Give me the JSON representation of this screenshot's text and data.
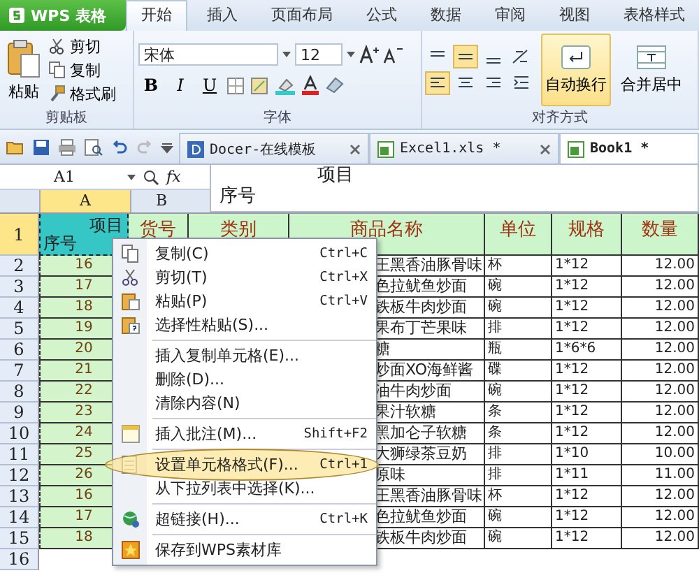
{
  "app_button": {
    "label": "WPS 表格"
  },
  "ribbon_tabs": [
    {
      "label": "开始",
      "selected": true
    },
    {
      "label": "插入",
      "selected": false
    },
    {
      "label": "页面布局",
      "selected": false
    },
    {
      "label": "公式",
      "selected": false
    },
    {
      "label": "数据",
      "selected": false
    },
    {
      "label": "审阅",
      "selected": false
    },
    {
      "label": "视图",
      "selected": false
    },
    {
      "label": "表格样式",
      "selected": false
    }
  ],
  "ribbon": {
    "clipboard": {
      "paste": "粘贴",
      "cut": "剪切",
      "copy": "复制",
      "format_painter": "格式刷",
      "group_label": "剪贴板"
    },
    "font": {
      "name": "宋体",
      "size": "12",
      "bold": "B",
      "italic": "I",
      "underline": "U",
      "group_label": "字体"
    },
    "alignment": {
      "wrap_text": {
        "label": "自动换行",
        "on": true
      },
      "merge_center": "合并居中",
      "group_label": "对齐方式"
    }
  },
  "document_tabs": [
    {
      "label": "Docer-在线模板",
      "selected": false
    },
    {
      "label": "Excel1.xls *",
      "selected": false
    },
    {
      "label": "Book1 *",
      "selected": true
    }
  ],
  "formula_bar": {
    "cell_ref": "A1",
    "fx": "fx",
    "popup_lines": [
      "项目",
      "序号"
    ]
  },
  "column_headers": [
    {
      "label": "A",
      "selected": true
    },
    {
      "label": "B",
      "selected": false
    }
  ],
  "header_row": {
    "row": "1",
    "selected": true,
    "first_cell": {
      "top": "项目",
      "bottom": "序号"
    },
    "cells": [
      "货号",
      "类别",
      "商品名称",
      "单位",
      "规格",
      "数量"
    ]
  },
  "rows": [
    {
      "row": "2",
      "no": "16",
      "name": "王黑香油豚骨味",
      "unit": "杯",
      "spec": "1*12",
      "qty": "12.00"
    },
    {
      "row": "3",
      "no": "17",
      "name": "色拉鱿鱼炒面",
      "unit": "碗",
      "spec": "1*12",
      "qty": "12.00"
    },
    {
      "row": "4",
      "no": "18",
      "name": "铁板牛肉炒面",
      "unit": "碗",
      "spec": "1*12",
      "qty": "12.00"
    },
    {
      "row": "5",
      "no": "19",
      "name": "果布丁芒果味",
      "unit": "排",
      "spec": "1*12",
      "qty": "12.00"
    },
    {
      "row": "6",
      "no": "20",
      "name": "糖",
      "unit": "瓶",
      "spec": "1*6*6",
      "qty": "12.00"
    },
    {
      "row": "7",
      "no": "21",
      "name": "炒面XO海鲜酱",
      "unit": "碟",
      "spec": "1*12",
      "qty": "12.00"
    },
    {
      "row": "8",
      "no": "22",
      "name": "油牛肉炒面",
      "unit": "碗",
      "spec": "1*12",
      "qty": "12.00"
    },
    {
      "row": "9",
      "no": "23",
      "name": "果汁软糖",
      "unit": "条",
      "spec": "1*12",
      "qty": "12.00"
    },
    {
      "row": "10",
      "no": "24",
      "name": "黑加仑子软糖",
      "unit": "条",
      "spec": "1*12",
      "qty": "12.00"
    },
    {
      "row": "11",
      "no": "25",
      "name": "大狮绿茶豆奶",
      "unit": "排",
      "spec": "1*10",
      "qty": "10.00"
    },
    {
      "row": "12",
      "no": "26",
      "name": "原味",
      "unit": "排",
      "spec": "1*11",
      "qty": "11.00"
    },
    {
      "row": "13",
      "no": "16",
      "name": "王黑香油豚骨味",
      "unit": "杯",
      "spec": "1*12",
      "qty": "12.00"
    },
    {
      "row": "14",
      "no": "17",
      "name": "色拉鱿鱼炒面",
      "unit": "碗",
      "spec": "1*12",
      "qty": "12.00"
    },
    {
      "row": "15",
      "no": "18",
      "name": "铁板牛肉炒面",
      "unit": "碗",
      "spec": "1*12",
      "qty": "12.00"
    }
  ],
  "empty_rows": [
    "16"
  ],
  "context_menu": [
    {
      "kind": "item",
      "label": "复制(C)",
      "shortcut": "Ctrl+C",
      "highlighted": false
    },
    {
      "kind": "item",
      "label": "剪切(T)",
      "shortcut": "Ctrl+X",
      "highlighted": false
    },
    {
      "kind": "item",
      "label": "粘贴(P)",
      "shortcut": "Ctrl+V",
      "highlighted": false
    },
    {
      "kind": "item",
      "label": "选择性粘贴(S)...",
      "highlighted": false
    },
    {
      "kind": "separator"
    },
    {
      "kind": "item",
      "label": "插入复制单元格(E)...",
      "highlighted": false
    },
    {
      "kind": "item",
      "label": "删除(D)...",
      "highlighted": false
    },
    {
      "kind": "item",
      "label": "清除内容(N)",
      "highlighted": false
    },
    {
      "kind": "separator"
    },
    {
      "kind": "item",
      "label": "插入批注(M)...",
      "shortcut": "Shift+F2",
      "highlighted": false
    },
    {
      "kind": "separator"
    },
    {
      "kind": "item",
      "label": "设置单元格格式(F)...",
      "shortcut": "Ctrl+1",
      "highlighted": true
    },
    {
      "kind": "item",
      "label": "从下拉列表中选择(K)...",
      "highlighted": false
    },
    {
      "kind": "separator"
    },
    {
      "kind": "item",
      "label": "超链接(H)...",
      "shortcut": "Ctrl+K",
      "highlighted": false
    },
    {
      "kind": "separator"
    },
    {
      "kind": "item",
      "label": "保存到WPS素材库",
      "highlighted": false
    }
  ]
}
